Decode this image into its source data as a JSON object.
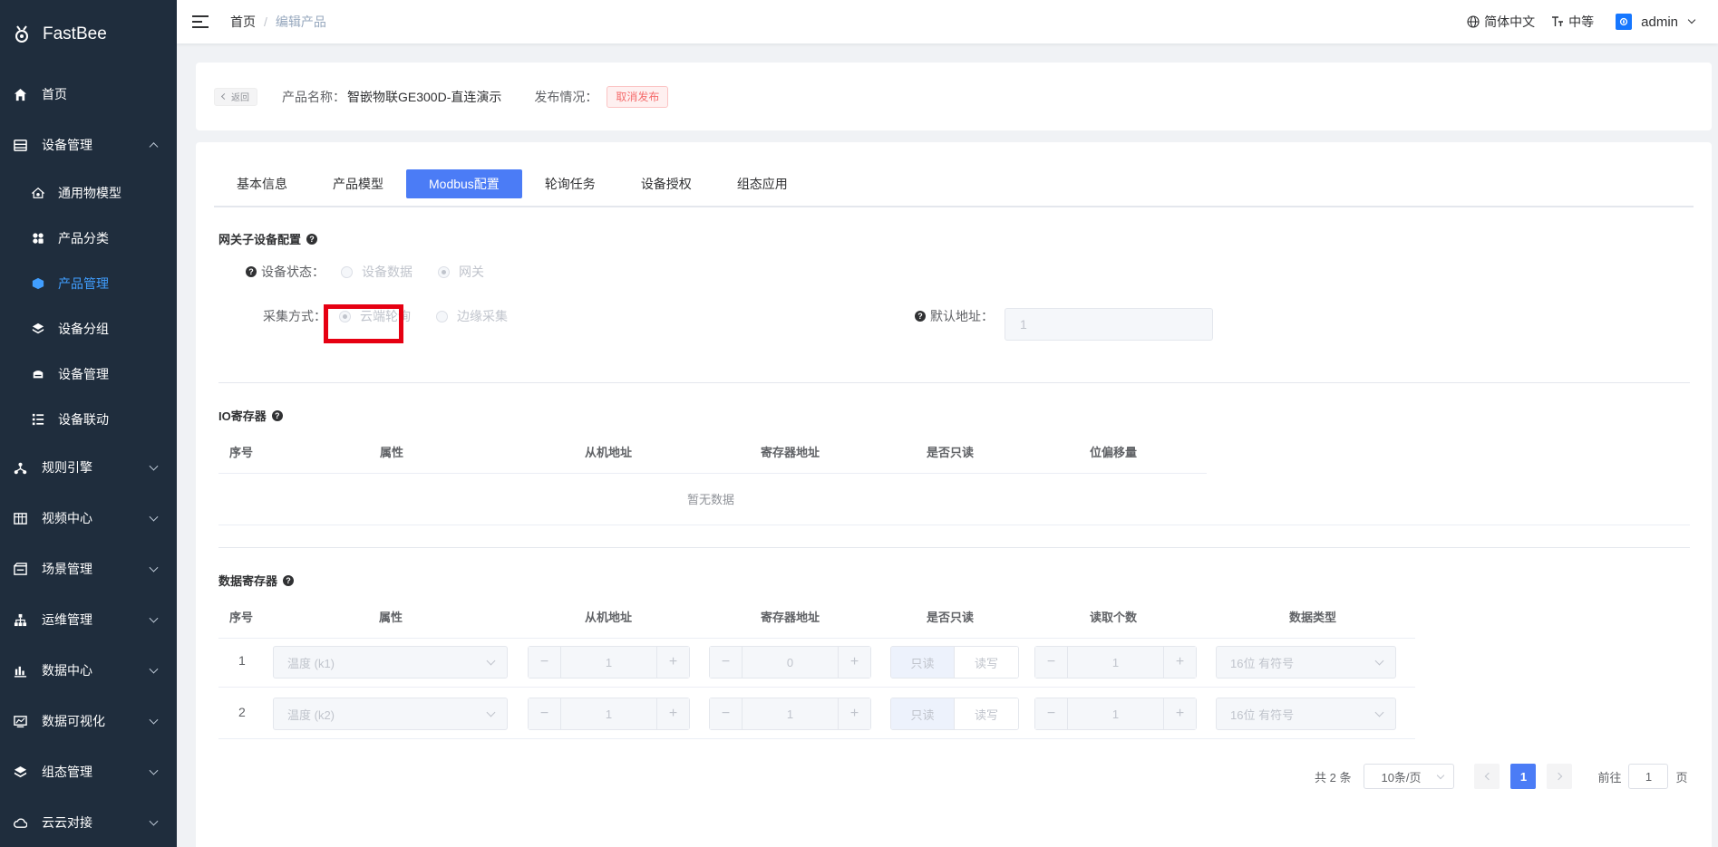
{
  "app": {
    "name": "FastBee"
  },
  "sidebar": {
    "items": [
      {
        "label": "首页",
        "icon": "home-icon"
      },
      {
        "label": "设备管理",
        "icon": "device-manage-icon",
        "expanded": true,
        "children": [
          {
            "label": "通用物模型",
            "icon": "model-icon"
          },
          {
            "label": "产品分类",
            "icon": "category-icon"
          },
          {
            "label": "产品管理",
            "icon": "cube-icon",
            "active": true
          },
          {
            "label": "设备分组",
            "icon": "layers-icon"
          },
          {
            "label": "设备管理",
            "icon": "device-icon"
          },
          {
            "label": "设备联动",
            "icon": "link-icon"
          }
        ]
      },
      {
        "label": "规则引擎",
        "icon": "rule-icon"
      },
      {
        "label": "视频中心",
        "icon": "video-icon"
      },
      {
        "label": "场景管理",
        "icon": "scene-icon"
      },
      {
        "label": "运维管理",
        "icon": "ops-icon"
      },
      {
        "label": "数据中心",
        "icon": "data-center-icon"
      },
      {
        "label": "数据可视化",
        "icon": "visual-icon"
      },
      {
        "label": "组态管理",
        "icon": "config-icon"
      },
      {
        "label": "云云对接",
        "icon": "cloud-icon"
      }
    ]
  },
  "header": {
    "breadcrumb": [
      "首页",
      "编辑产品"
    ],
    "language": "简体中文",
    "font_size": "中等",
    "user": "admin"
  },
  "product_bar": {
    "back_label": "返回",
    "name_label": "产品名称：",
    "name_value": "智嵌物联GE300D-直连演示",
    "publish_label": "发布情况：",
    "publish_tag": "取消发布"
  },
  "tabs": [
    {
      "label": "基本信息"
    },
    {
      "label": "产品模型"
    },
    {
      "label": "Modbus配置",
      "active": true
    },
    {
      "label": "轮询任务"
    },
    {
      "label": "设备授权"
    },
    {
      "label": "组态应用"
    }
  ],
  "gateway": {
    "title": "网关子设备配置",
    "status_label": "设备状态：",
    "status_options": [
      "设备数据",
      "网关"
    ],
    "status_selected": 1,
    "collect_label": "采集方式：",
    "collect_options": [
      "云端轮询",
      "边缘采集"
    ],
    "collect_selected": 0,
    "address_label": "默认地址：",
    "address_value": "1"
  },
  "io_registers": {
    "title": "IO寄存器",
    "columns": [
      "序号",
      "属性",
      "从机地址",
      "寄存器地址",
      "是否只读",
      "位偏移量"
    ],
    "empty_text": "暂无数据"
  },
  "data_registers": {
    "title": "数据寄存器",
    "columns": [
      "序号",
      "属性",
      "从机地址",
      "寄存器地址",
      "是否只读",
      "读取个数",
      "数据类型"
    ],
    "rows": [
      {
        "index": "1",
        "property": "温度 (k1)",
        "slave": "1",
        "register": "0",
        "readonly": [
          "只读",
          "读写"
        ],
        "count": "1",
        "type": "16位 有符号"
      },
      {
        "index": "2",
        "property": "温度 (k2)",
        "slave": "1",
        "register": "1",
        "readonly": [
          "只读",
          "读写"
        ],
        "count": "1",
        "type": "16位 有符号"
      }
    ]
  },
  "pagination": {
    "total": "共 2 条",
    "page_size": "10条/页",
    "current": "1",
    "goto_prefix": "前往",
    "goto_value": "1",
    "goto_suffix": "页"
  },
  "colors": {
    "sidebar_bg": "#1f2d3d",
    "active_blue": "#409eff",
    "tab_active": "#4b7cf6",
    "highlight_red": "#e60012"
  }
}
